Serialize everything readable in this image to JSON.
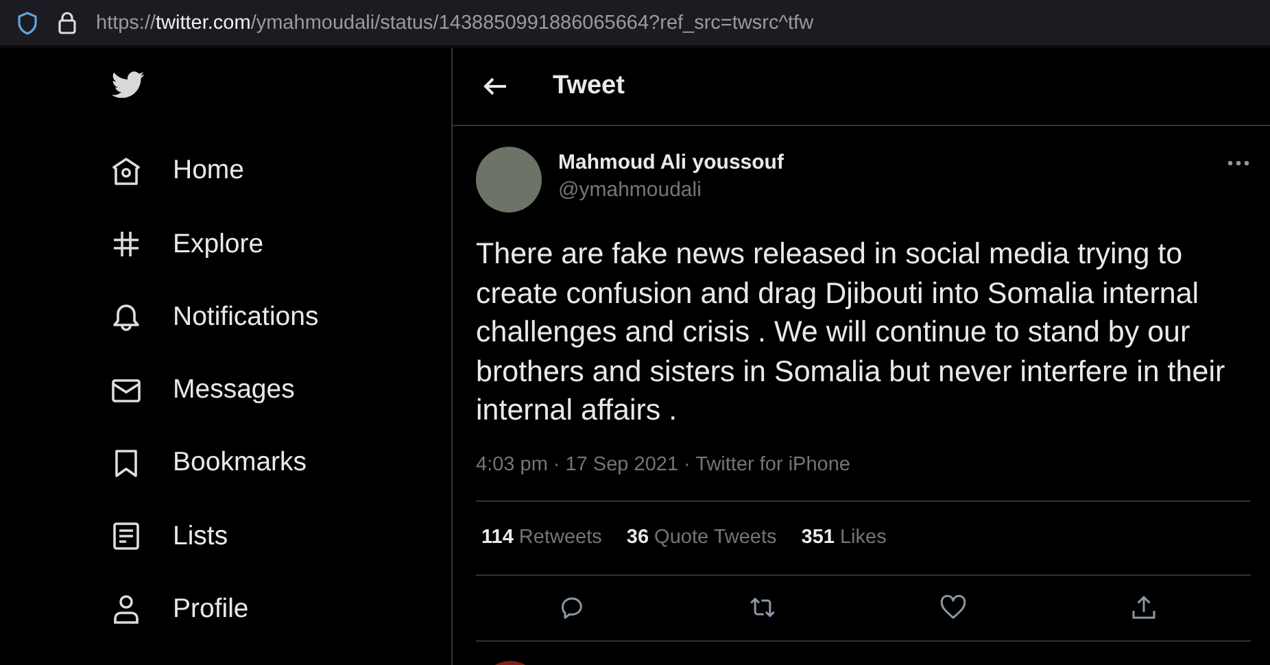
{
  "address_bar": {
    "scheme": "https://",
    "host": "twitter.com",
    "path": "/ymahmoudali/status/1438850991886065664?ref_src=twsrc^tfw"
  },
  "sidebar": {
    "items": [
      {
        "label": "Home",
        "kind": "home"
      },
      {
        "label": "Explore",
        "kind": "explore"
      },
      {
        "label": "Notifications",
        "kind": "notifications"
      },
      {
        "label": "Messages",
        "kind": "messages"
      },
      {
        "label": "Bookmarks",
        "kind": "bookmarks"
      },
      {
        "label": "Lists",
        "kind": "lists"
      },
      {
        "label": "Profile",
        "kind": "profile"
      }
    ]
  },
  "header": {
    "title": "Tweet"
  },
  "tweet": {
    "author": "Mahmoud Ali youssouf",
    "handle": "@ymahmoudali",
    "text": "There are fake news released in social media trying to create confusion and drag Djibouti  into Somalia internal challenges and crisis . We will continue to stand by our brothers and sisters in Somalia but never interfere in their internal affairs .",
    "meta": "4:03 pm · 17 Sep 2021 · Twitter for iPhone",
    "stats": [
      {
        "count": "114",
        "label": "Retweets"
      },
      {
        "count": "36",
        "label": "Quote Tweets"
      },
      {
        "count": "351",
        "label": "Likes"
      }
    ]
  }
}
